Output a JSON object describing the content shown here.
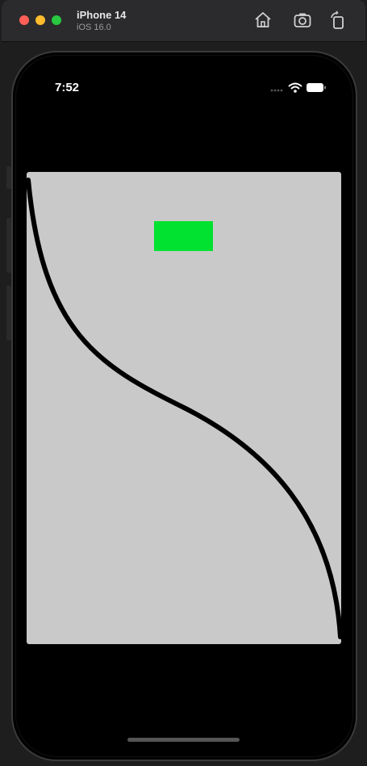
{
  "titlebar": {
    "device_name": "iPhone 14",
    "os_version": "iOS 16.0",
    "icons": [
      "home-icon",
      "screenshot-icon",
      "rotate-icon"
    ]
  },
  "status_bar": {
    "time": "7:52",
    "icons": [
      "cellular-dots-icon",
      "wifi-icon",
      "battery-icon"
    ]
  },
  "app": {
    "canvas_color": "#c9c9c9",
    "rect_color": "#00e130",
    "curve_color": "#000000"
  }
}
